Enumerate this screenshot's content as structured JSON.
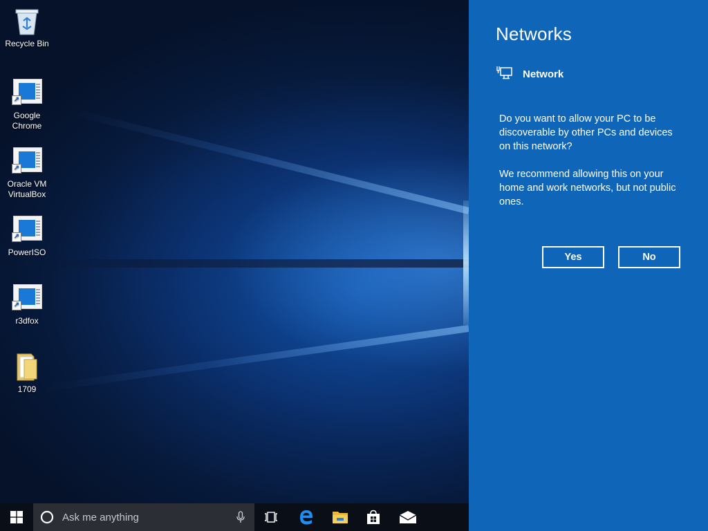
{
  "desktop": {
    "icons": [
      {
        "label": "Recycle Bin",
        "icon": "recycle-bin-icon"
      },
      {
        "label": "Google\nChrome",
        "icon": "shortcut-icon"
      },
      {
        "label": "Oracle VM\nVirtualBox",
        "icon": "shortcut-icon"
      },
      {
        "label": "PowerISO",
        "icon": "shortcut-icon"
      },
      {
        "label": "r3dfox",
        "icon": "shortcut-icon"
      },
      {
        "label": "1709",
        "icon": "folder-icon"
      }
    ]
  },
  "flyout": {
    "title": "Networks",
    "network_name": "Network",
    "network_icon": "wired-network-icon",
    "question": "Do you want to allow your PC to be discoverable by other PCs and devices on this network?",
    "recommendation": "We recommend allowing this on your home and work networks, but not public ones.",
    "yes_label": "Yes",
    "no_label": "No",
    "background_color": "#0f66b9"
  },
  "taskbar": {
    "search_placeholder": "Ask me anything",
    "icons": [
      "windows-start-icon",
      "cortana-icon",
      "microphone-icon",
      "task-view-icon",
      "edge-icon",
      "file-explorer-icon",
      "store-icon",
      "mail-icon"
    ]
  }
}
